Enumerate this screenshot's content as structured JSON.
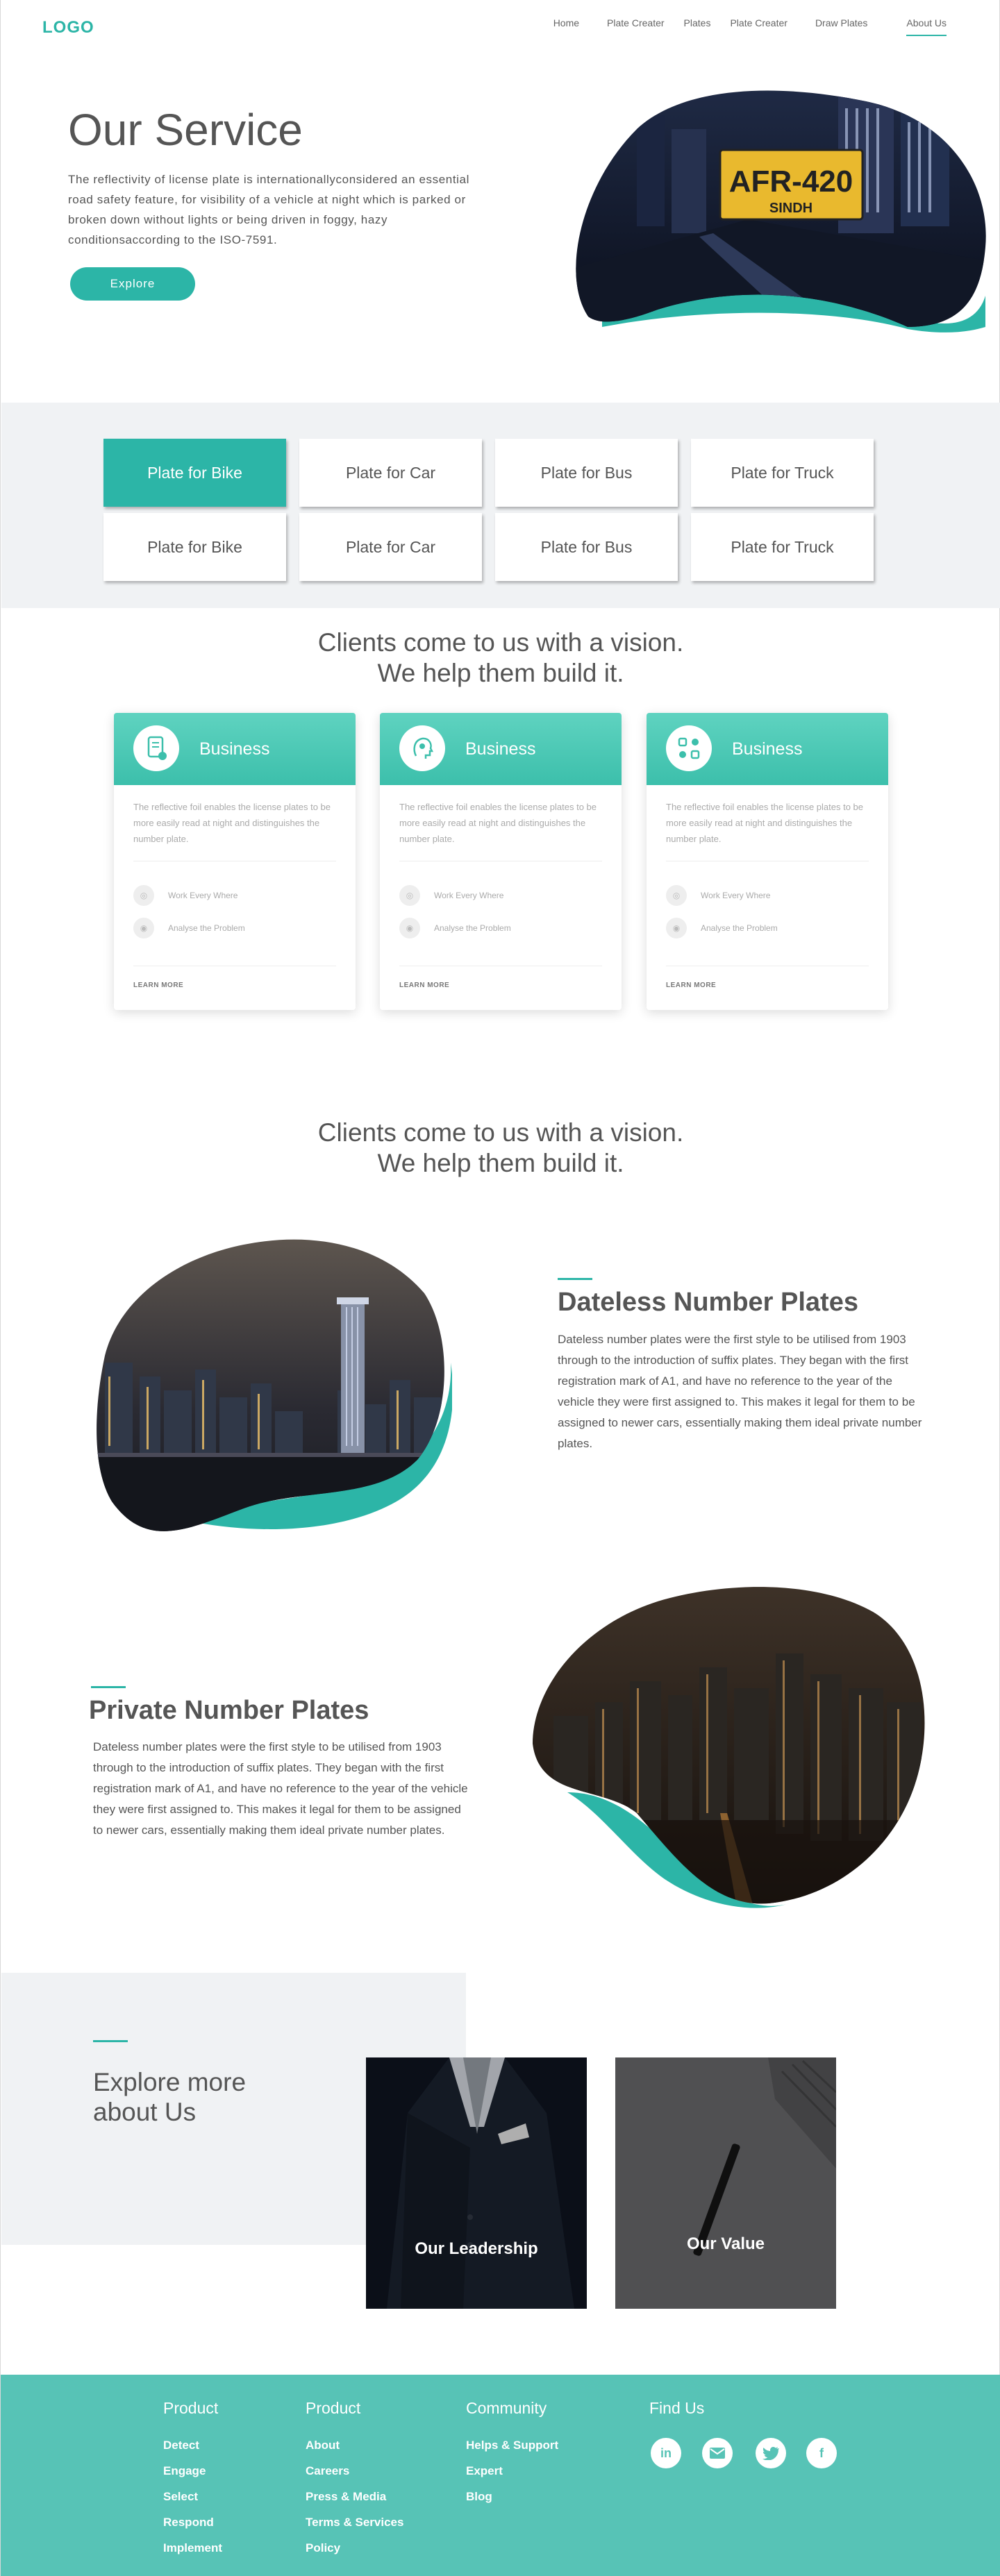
{
  "header": {
    "logo": "LOGO",
    "nav": [
      "Home",
      "Plate Creater",
      "Plates",
      "Plate Creater",
      "Draw Plates",
      "About Us"
    ],
    "active": "About Us"
  },
  "hero": {
    "title": "Our Service",
    "text": "The reflectivity of license plate is internationallyconsidered an essential road safety feature, for visibility of a vehicle at night which is parked or broken down without lights or being driven in foggy, hazy conditionsaccording to the ISO-7591.",
    "button": "Explore",
    "plate_text": "AFR-420",
    "plate_sub": "SINDH"
  },
  "plates": {
    "row1": [
      "Plate for Bike",
      "Plate for Car",
      "Plate for Bus",
      "Plate for Truck"
    ],
    "row2": [
      "Plate for Bike",
      "Plate for Car",
      "Plate for Bus",
      "Plate for Truck"
    ],
    "selected": "row1-0"
  },
  "clients": {
    "heading_line1": "Clients come to us with a vision.",
    "heading_line2": "We help them build it.",
    "cards": [
      {
        "title": "Business",
        "icon": "document-edit-icon",
        "desc": "The reflective foil enables the license plates to be more easily read at night and distinguishes the number plate.",
        "feat1": "Work Every Where",
        "feat2": "Analyse the Problem",
        "more": "LEARN MORE"
      },
      {
        "title": "Business",
        "icon": "head-gear-icon",
        "desc": "The reflective foil enables the license plates to be more easily read at night and distinguishes the number plate.",
        "feat1": "Work Every Where",
        "feat2": "Analyse the Problem",
        "more": "LEARN MORE"
      },
      {
        "title": "Business",
        "icon": "workflow-icon",
        "desc": "The reflective foil enables the license plates to be more easily read at night and distinguishes the number plate.",
        "feat1": "Work Every Where",
        "feat2": "Analyse the Problem",
        "more": "LEARN MORE"
      }
    ]
  },
  "clients2": {
    "heading_line1": "Clients come to us with a vision.",
    "heading_line2": "We help them build it."
  },
  "feature1": {
    "title": "Dateless Number Plates",
    "text": "Dateless number plates were the first style to be utilised from 1903 through to the introduction of suffix plates. They began with the first registration mark of A1, and have no reference to the year of the vehicle they were first assigned to. This makes it legal for them to be assigned to newer cars, essentially making them ideal private number plates."
  },
  "feature2": {
    "title": "Private Number Plates",
    "text": "Dateless number plates were the first style to be utilised from 1903 through to the introduction of suffix plates. They began with the first registration mark of A1, and have no reference to the year of the vehicle they were first assigned to. This makes it legal for them to be assigned to newer cars, essentially making them ideal private number plates."
  },
  "explore": {
    "title_line1": "Explore more",
    "title_line2": "about Us",
    "tiles": [
      "Our Leadership",
      "Our Value"
    ]
  },
  "footer": {
    "col1": {
      "head": "Product",
      "links": [
        "Detect",
        "Engage",
        "Select",
        "Respond",
        "Implement"
      ]
    },
    "col2": {
      "head": "Product",
      "links": [
        "About",
        "Careers",
        "Press & Media",
        "Terms & Services",
        "Policy"
      ]
    },
    "col3": {
      "head": "Community",
      "links": [
        "Helps & Support",
        "Expert",
        "Blog"
      ]
    },
    "col4": {
      "head": "Find Us"
    },
    "social": [
      "linkedin-icon",
      "mail-icon",
      "twitter-icon",
      "facebook-icon"
    ]
  },
  "colors": {
    "accent": "#2cb5a7",
    "footer": "#57c3b6",
    "band": "#f0f2f4"
  }
}
